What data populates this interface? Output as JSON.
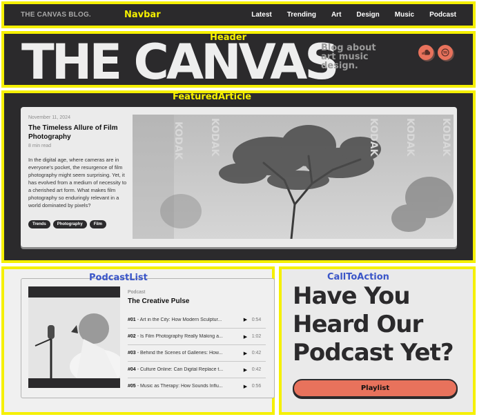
{
  "navbar": {
    "region_label": "Navbar",
    "brand": "THE CANVAS BLOG.",
    "links": [
      "Latest",
      "Trending",
      "Art",
      "Design",
      "Music",
      "Podcast"
    ]
  },
  "header": {
    "region_label": "Header",
    "title": "THE CANVAS",
    "tagline": "Blog about art music design.",
    "social_icons": [
      "soundcloud-icon",
      "spotify-icon"
    ]
  },
  "featured": {
    "region_label": "FeaturedArticle",
    "date": "November 11, 2024",
    "title": "The Timeless Allure of Film Photography",
    "read_time": "8 min read",
    "excerpt": "In the digital age, where cameras are in everyone's pocket, the resurgence of film photography might seem surprising. Yet, it has evolved from a medium of necessity to a cherished art form. What makes film photography so enduringly relevant in a world dominated by pixels?",
    "tags": [
      "Trends",
      "Photography",
      "Film"
    ],
    "image_watermark": "KODAK"
  },
  "podcasts": {
    "region_label": "PodcastList",
    "label": "Podcast",
    "show_title": "The Creative Pulse",
    "episodes": [
      {
        "num": "#01",
        "title": "- Art in the City: How Modern Sculptur...",
        "duration": "0:54"
      },
      {
        "num": "#02",
        "title": "- Is Film Photography Really Making a...",
        "duration": "1:02"
      },
      {
        "num": "#03",
        "title": "- Behind the Scenes of Galleries: How...",
        "duration": "0:42"
      },
      {
        "num": "#04",
        "title": "- Culture Online: Can Digital Replace t...",
        "duration": "0:42"
      },
      {
        "num": "#05",
        "title": "- Music as Therapy: How Sounds Influ...",
        "duration": "0:56"
      }
    ]
  },
  "cta": {
    "region_label": "CallToAction",
    "headline": "Have You Heard Our Podcast Yet?",
    "button": "Playlist"
  },
  "colors": {
    "dark": "#2b2a2c",
    "accent": "#e8725c",
    "annotation_yellow": "#f5f000",
    "annotation_blue": "#3a55c8"
  }
}
